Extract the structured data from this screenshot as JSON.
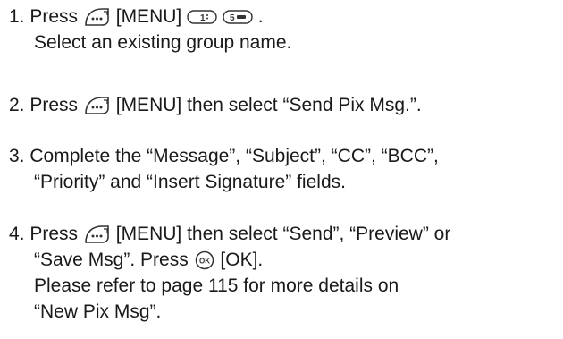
{
  "steps": [
    {
      "number": "1.",
      "line1": {
        "a": "Press",
        "b": "[MENU]",
        "c": "."
      },
      "line2": "Select an existing group name.",
      "icons": [
        "menu-soft-key-icon",
        "key-1-icon",
        "key-5-icon"
      ],
      "key_labels": {
        "k1": "1",
        "k5": "5"
      }
    },
    {
      "number": "2.",
      "line1": {
        "a": "Press",
        "b": "[MENU] then select “Send Pix Msg.”."
      },
      "icons": [
        "menu-soft-key-icon"
      ]
    },
    {
      "number": "3.",
      "line1": "Complete the “Message”, “Subject”, “CC”, “BCC”,",
      "line2": "“Priority” and “Insert Signature” fields."
    },
    {
      "number": "4.",
      "line1": {
        "a": "Press",
        "b": "[MENU] then select “Send”, “Preview” or"
      },
      "line2": {
        "a": "“Save Msg”. Press",
        "b": "[OK]."
      },
      "line3": "Please refer to page 115 for more details on",
      "line4": "“New Pix Msg”.",
      "icons": [
        "menu-soft-key-icon",
        "ok-key-icon"
      ],
      "ok_label": "OK"
    }
  ]
}
